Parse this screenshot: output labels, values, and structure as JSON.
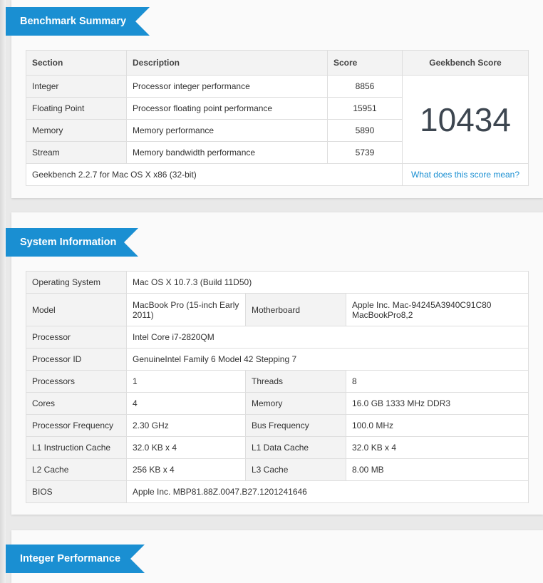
{
  "summary": {
    "title": "Benchmark Summary",
    "headers": {
      "section": "Section",
      "description": "Description",
      "score": "Score",
      "geekbench": "Geekbench Score"
    },
    "rows": [
      {
        "section": "Integer",
        "description": "Processor integer performance",
        "score": "8856"
      },
      {
        "section": "Floating Point",
        "description": "Processor floating point performance",
        "score": "15951"
      },
      {
        "section": "Memory",
        "description": "Memory performance",
        "score": "5890"
      },
      {
        "section": "Stream",
        "description": "Memory bandwidth performance",
        "score": "5739"
      }
    ],
    "geekbench_score": "10434",
    "footer_version": "Geekbench 2.2.7 for Mac OS X x86 (32-bit)",
    "footer_link": "What does this score mean?"
  },
  "sysinfo": {
    "title": "System Information",
    "os": {
      "label": "Operating System",
      "value": "Mac OS X 10.7.3 (Build 11D50)"
    },
    "model": {
      "label": "Model",
      "value": "MacBook Pro (15-inch Early 2011)"
    },
    "motherboard": {
      "label": "Motherboard",
      "value": "Apple Inc. Mac-94245A3940C91C80 MacBookPro8,2"
    },
    "processor": {
      "label": "Processor",
      "value": "Intel Core i7-2820QM"
    },
    "processor_id": {
      "label": "Processor ID",
      "value": "GenuineIntel Family 6 Model 42 Stepping 7"
    },
    "processors": {
      "label": "Processors",
      "value": "1"
    },
    "threads": {
      "label": "Threads",
      "value": "8"
    },
    "cores": {
      "label": "Cores",
      "value": "4"
    },
    "memory": {
      "label": "Memory",
      "value": "16.0 GB 1333 MHz DDR3"
    },
    "proc_freq": {
      "label": "Processor Frequency",
      "value": "2.30 GHz"
    },
    "bus_freq": {
      "label": "Bus Frequency",
      "value": "100.0 MHz"
    },
    "l1i": {
      "label": "L1 Instruction Cache",
      "value": "32.0 KB x 4"
    },
    "l1d": {
      "label": "L1 Data Cache",
      "value": "32.0 KB x 4"
    },
    "l2": {
      "label": "L2 Cache",
      "value": "256 KB x 4"
    },
    "l3": {
      "label": "L3 Cache",
      "value": "8.00 MB"
    },
    "bios": {
      "label": "BIOS",
      "value": "Apple Inc. MBP81.88Z.0047.B27.1201241646"
    }
  },
  "integer": {
    "title": "Integer Performance"
  },
  "colors": {
    "accent": "#1a8fd2",
    "score_text": "#3d4650"
  }
}
